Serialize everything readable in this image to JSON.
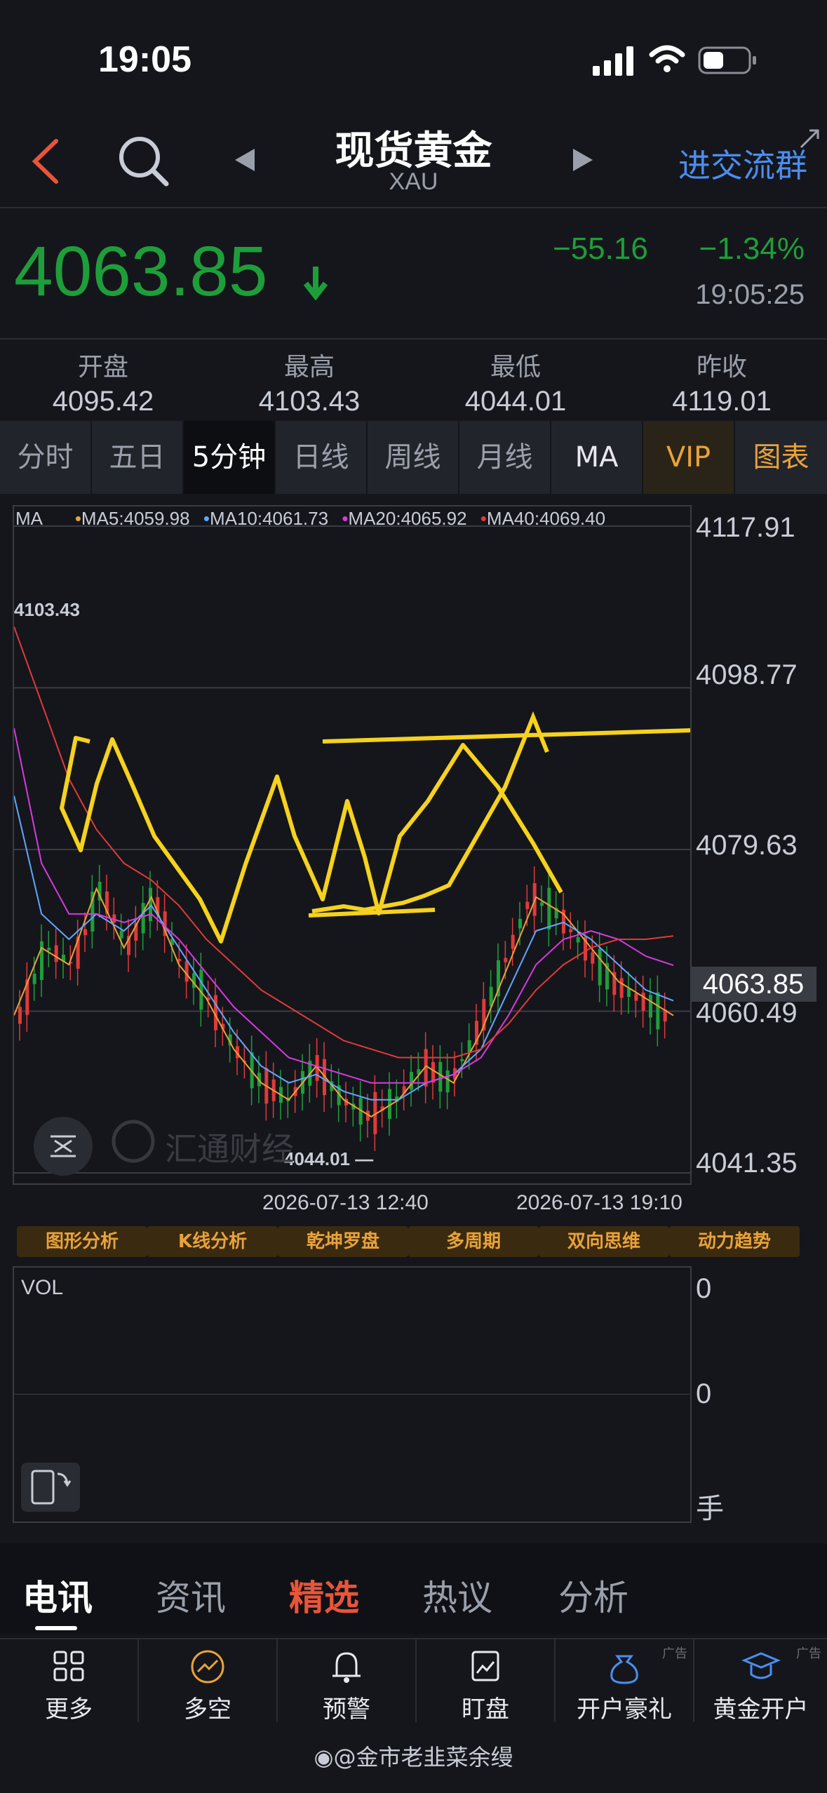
{
  "status_bar": {
    "time": "19:05"
  },
  "header": {
    "title": "现货黄金",
    "subtitle": "XAU",
    "join_label": "进交流群"
  },
  "quote": {
    "price": "4063.85",
    "change": "−55.16",
    "change_pct": "−1.34%",
    "timestamp": "19:05:25"
  },
  "stats": [
    {
      "label": "开盘",
      "value": "4095.42"
    },
    {
      "label": "最高",
      "value": "4103.43"
    },
    {
      "label": "最低",
      "value": "4044.01"
    },
    {
      "label": "昨收",
      "value": "4119.01"
    }
  ],
  "period_tabs": [
    "分时",
    "五日",
    "5分钟",
    "日线",
    "周线",
    "月线",
    "MA",
    "VIP",
    "图表"
  ],
  "active_tab": "5分钟",
  "chart_legend": {
    "ma": "MA",
    "ma5": "MA5:4059.98",
    "ma10": "MA10:4061.73",
    "ma20": "MA20:4065.92",
    "ma40": "MA40:4069.40"
  },
  "chart_labels": {
    "high_marker": "4103.43",
    "low_marker": "4044.01 —",
    "watermark": "汇通财经",
    "x_start": "2026-07-13 12:40",
    "x_end": "2026-07-13 19:10",
    "current_price_tag": "4063.85"
  },
  "chart_data": {
    "type": "line",
    "y_ticks": [
      "4117.91",
      "4098.77",
      "4079.63",
      "4060.49",
      "4041.35"
    ],
    "ylim": [
      4041.35,
      4117.91
    ],
    "x_ticks": [
      "2026-07-13 12:40",
      "2026-07-13 19:10"
    ],
    "series": [
      {
        "name": "MA5",
        "values": [
          4060.0,
          4068,
          4066,
          4075,
          4068,
          4074,
          4066,
          4062,
          4056,
          4052,
          4050,
          4054,
          4050,
          4048,
          4050,
          4054,
          4052,
          4058,
          4066,
          4074,
          4072,
          4068,
          4064,
          4062,
          4059.98
        ]
      },
      {
        "name": "MA10",
        "values": [
          4086.0,
          4072,
          4069,
          4072,
          4070,
          4073,
          4068,
          4063,
          4058,
          4054,
          4052,
          4053,
          4051,
          4050,
          4050,
          4052,
          4053,
          4056,
          4063,
          4070,
          4071,
          4069,
          4066,
          4063,
          4061.73
        ]
      },
      {
        "name": "MA20",
        "values": [
          4094.0,
          4078,
          4072,
          4072,
          4071,
          4072,
          4069,
          4065,
          4061,
          4058,
          4055,
          4054,
          4053,
          4052,
          4052,
          4052,
          4053,
          4055,
          4060,
          4066,
          4069,
          4070,
          4069,
          4067,
          4065.92
        ]
      },
      {
        "name": "MA40",
        "values": [
          4106.0,
          4097,
          4088,
          4082,
          4078,
          4076,
          4073,
          4069,
          4066,
          4063,
          4061,
          4059,
          4057,
          4056,
          4055,
          4055,
          4055,
          4056,
          4059,
          4063,
          4066,
          4068,
          4069,
          4069,
          4069.4
        ]
      }
    ]
  },
  "indicator_buttons": [
    "图形分析",
    "K线分析",
    "乾坤罗盘",
    "多周期",
    "双向思维",
    "动力趋势"
  ],
  "volume_panel": {
    "label": "VOL",
    "y_top": "0",
    "y_mid": "0",
    "unit": "手"
  },
  "news_tabs": [
    "电讯",
    "资讯",
    "精选",
    "热议",
    "分析"
  ],
  "active_news_tab": "电讯",
  "bottom_nav": [
    {
      "label": "更多",
      "icon": "grid-icon"
    },
    {
      "label": "多空",
      "icon": "trend-icon"
    },
    {
      "label": "预警",
      "icon": "bell-icon"
    },
    {
      "label": "盯盘",
      "icon": "watch-chart-icon"
    },
    {
      "label": "开户豪礼",
      "icon": "money-bag-icon",
      "ad": "广告"
    },
    {
      "label": "黄金开户",
      "icon": "graduation-icon",
      "ad": "广告"
    }
  ],
  "footer": {
    "watermark": "@金市老韭菜余缦"
  },
  "colors": {
    "up": "#e03a3a",
    "down": "#1e9e3a",
    "accent": "#4b8ef0",
    "vip": "#e8a23a",
    "drawing": "#f5d21e"
  }
}
